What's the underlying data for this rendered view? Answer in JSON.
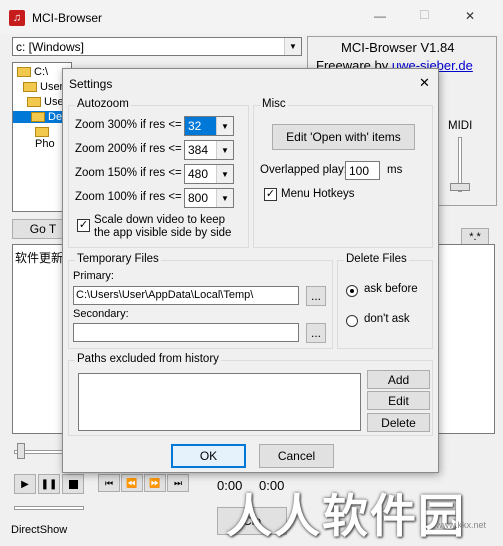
{
  "window": {
    "title": "MCI-Browser",
    "minimize": "—",
    "maximize": "☐",
    "close": "✕"
  },
  "main": {
    "drive": "c: [Windows]",
    "app_name": "MCI-Browser V1.84",
    "freeware_prefix": "Freeware by ",
    "freeware_link": "uwe-sieber.de",
    "tree": [
      "C:\\",
      "Users",
      "User",
      "Des",
      "Pho"
    ],
    "go_to": "Go T",
    "star_button": "*.*",
    "list_item": "软件更新",
    "midi": "MIDI",
    "time1": "0:00",
    "time2": "0:00",
    "directshow": "DirectShow",
    "close_btn": "Clo",
    "watermark": "人人软件园",
    "watermark_url": "www.kkx.net"
  },
  "dialog": {
    "title": "Settings",
    "close": "✕",
    "autozoom": {
      "label": "Autozoom",
      "rows": [
        {
          "label": "Zoom 300% if res <=",
          "value": "32"
        },
        {
          "label": "Zoom 200% if res <=",
          "value": "384"
        },
        {
          "label": "Zoom 150% if res <=",
          "value": "480"
        },
        {
          "label": "Zoom 100% if res <=",
          "value": "800"
        }
      ],
      "scale_line1": "Scale down video to keep",
      "scale_line2": "the app visible side by side",
      "scale_checked": "✓"
    },
    "misc": {
      "label": "Misc",
      "edit_open_with": "Edit 'Open with' items",
      "overlapped_label": "Overlapped play:",
      "overlapped_value": "100",
      "overlapped_unit": "ms",
      "menu_hotkeys": "Menu Hotkeys",
      "menu_hotkeys_checked": "✓"
    },
    "temp": {
      "label": "Temporary Files",
      "primary_label": "Primary:",
      "primary_value": "C:\\Users\\User\\AppData\\Local\\Temp\\",
      "secondary_label": "Secondary:",
      "secondary_value": "",
      "browse": "..."
    },
    "delete": {
      "label": "Delete Files",
      "ask_before": "ask before",
      "dont_ask": "don't ask"
    },
    "paths": {
      "label": "Paths excluded from history",
      "add": "Add",
      "edit": "Edit",
      "delete": "Delete"
    },
    "ok": "OK",
    "cancel": "Cancel"
  }
}
